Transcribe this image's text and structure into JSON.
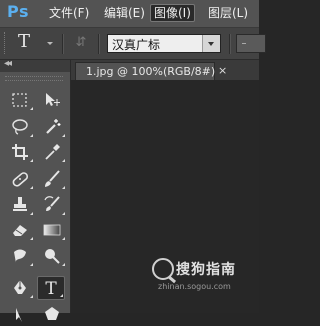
{
  "app": {
    "logo": "Ps"
  },
  "menubar": {
    "items": [
      {
        "label": "文件(F)"
      },
      {
        "label": "编辑(E)"
      },
      {
        "label": "图像(I)",
        "active": true
      },
      {
        "label": "图层(L)"
      }
    ]
  },
  "options": {
    "tool_glyph": "T",
    "orient_glyph": "⇵",
    "font_family": "汉真广标"
  },
  "document": {
    "tab_title": "1.jpg @ 100%(RGB/8#)",
    "close_glyph": "×"
  },
  "toolpanel": {
    "collapse_glyph": "◂◂",
    "text_tool_glyph": "T"
  },
  "watermark": {
    "name": "搜狗指南",
    "url": "zhinan.sogou.com"
  }
}
